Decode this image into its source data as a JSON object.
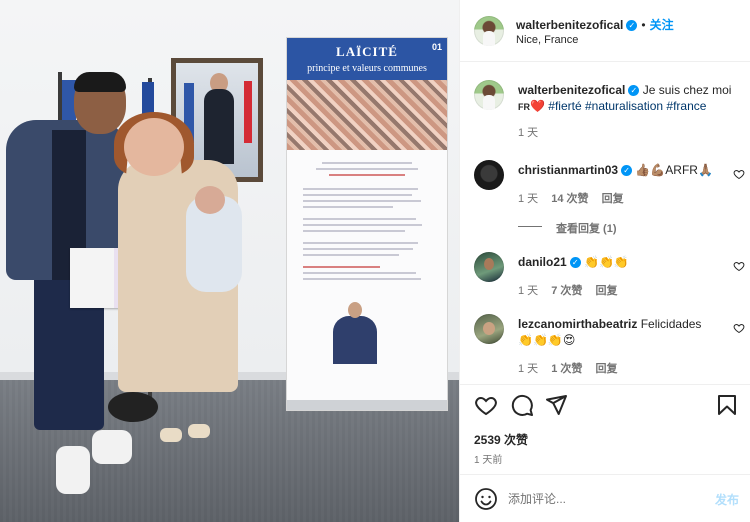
{
  "post_image": {
    "banner_title": "LAÏCITÉ",
    "banner_subtitle": "principe et valeurs communes",
    "banner_number": "01"
  },
  "header": {
    "username": "walterbenitezofical",
    "separator": "•",
    "follow_label": "关注",
    "location": "Nice, France",
    "more_label": "•••"
  },
  "caption": {
    "username": "walterbenitezofical",
    "text": "Je suis chez moi",
    "flag_text": "FR",
    "heart": "❤️",
    "hashtags": [
      "#fierté",
      "#naturalisation",
      "#france"
    ],
    "time": "1 天"
  },
  "comments": [
    {
      "username": "christianmartin03",
      "verified": true,
      "text": "👍🏽💪🏽ARFR🙏🏽",
      "time": "1 天",
      "likes": "14 次赞",
      "reply_label": "回复",
      "view_replies": "查看回复 (1)"
    },
    {
      "username": "danilo21",
      "verified": true,
      "text": "👏👏👏",
      "time": "1 天",
      "likes": "7 次赞",
      "reply_label": "回复"
    },
    {
      "username": "lezcanomirthabeatriz",
      "verified": false,
      "text": "Felicidades",
      "text2": "👏👏👏😍",
      "time": "1 天",
      "likes": "1 次赞",
      "reply_label": "回复"
    }
  ],
  "actions": {
    "likes_count": "2539 次赞",
    "date": "1 天前"
  },
  "add_comment": {
    "placeholder": "添加评论...",
    "post_label": "发布"
  },
  "colors": {
    "accent": "#0095f6",
    "hashtag": "#00376b",
    "muted": "#737373",
    "post_disabled": "#b2dffc"
  }
}
